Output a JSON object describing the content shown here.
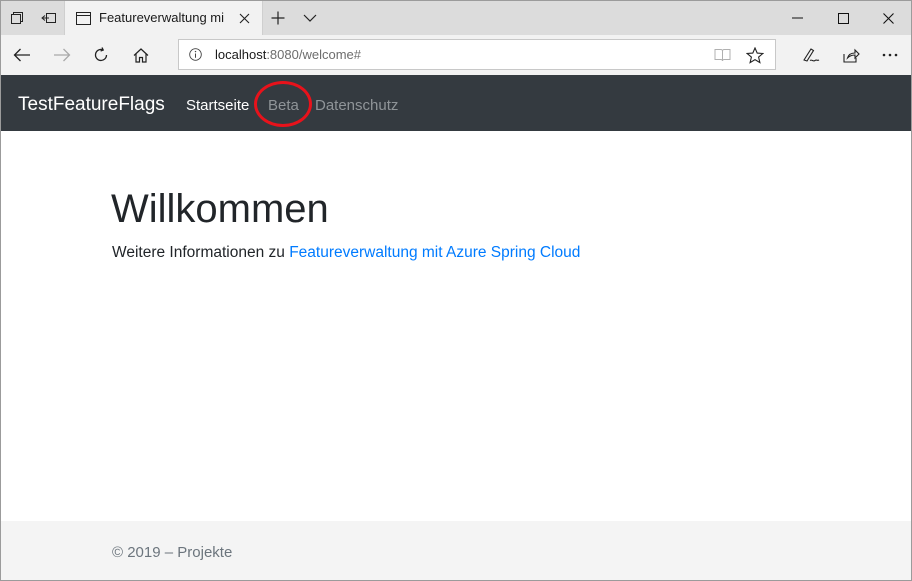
{
  "browser": {
    "tab_title": "Featureverwaltung mit",
    "url_host": "localhost",
    "url_rest": ":8080/welcome#"
  },
  "navbar": {
    "brand": "TestFeatureFlags",
    "links": [
      {
        "label": "Startseite",
        "state": "active"
      },
      {
        "label": "Beta",
        "state": "muted",
        "annotated": true
      },
      {
        "label": "Datenschutz",
        "state": "muted"
      }
    ]
  },
  "main": {
    "heading": "Willkommen",
    "lead_text": "Weitere Informationen zu ",
    "lead_link": "Featureverwaltung mit Azure Spring Cloud"
  },
  "footer": {
    "text": "© 2019 – Projekte"
  },
  "colors": {
    "navbar_bg": "#343a40",
    "link": "#007bff",
    "annotation": "#e8121b"
  }
}
